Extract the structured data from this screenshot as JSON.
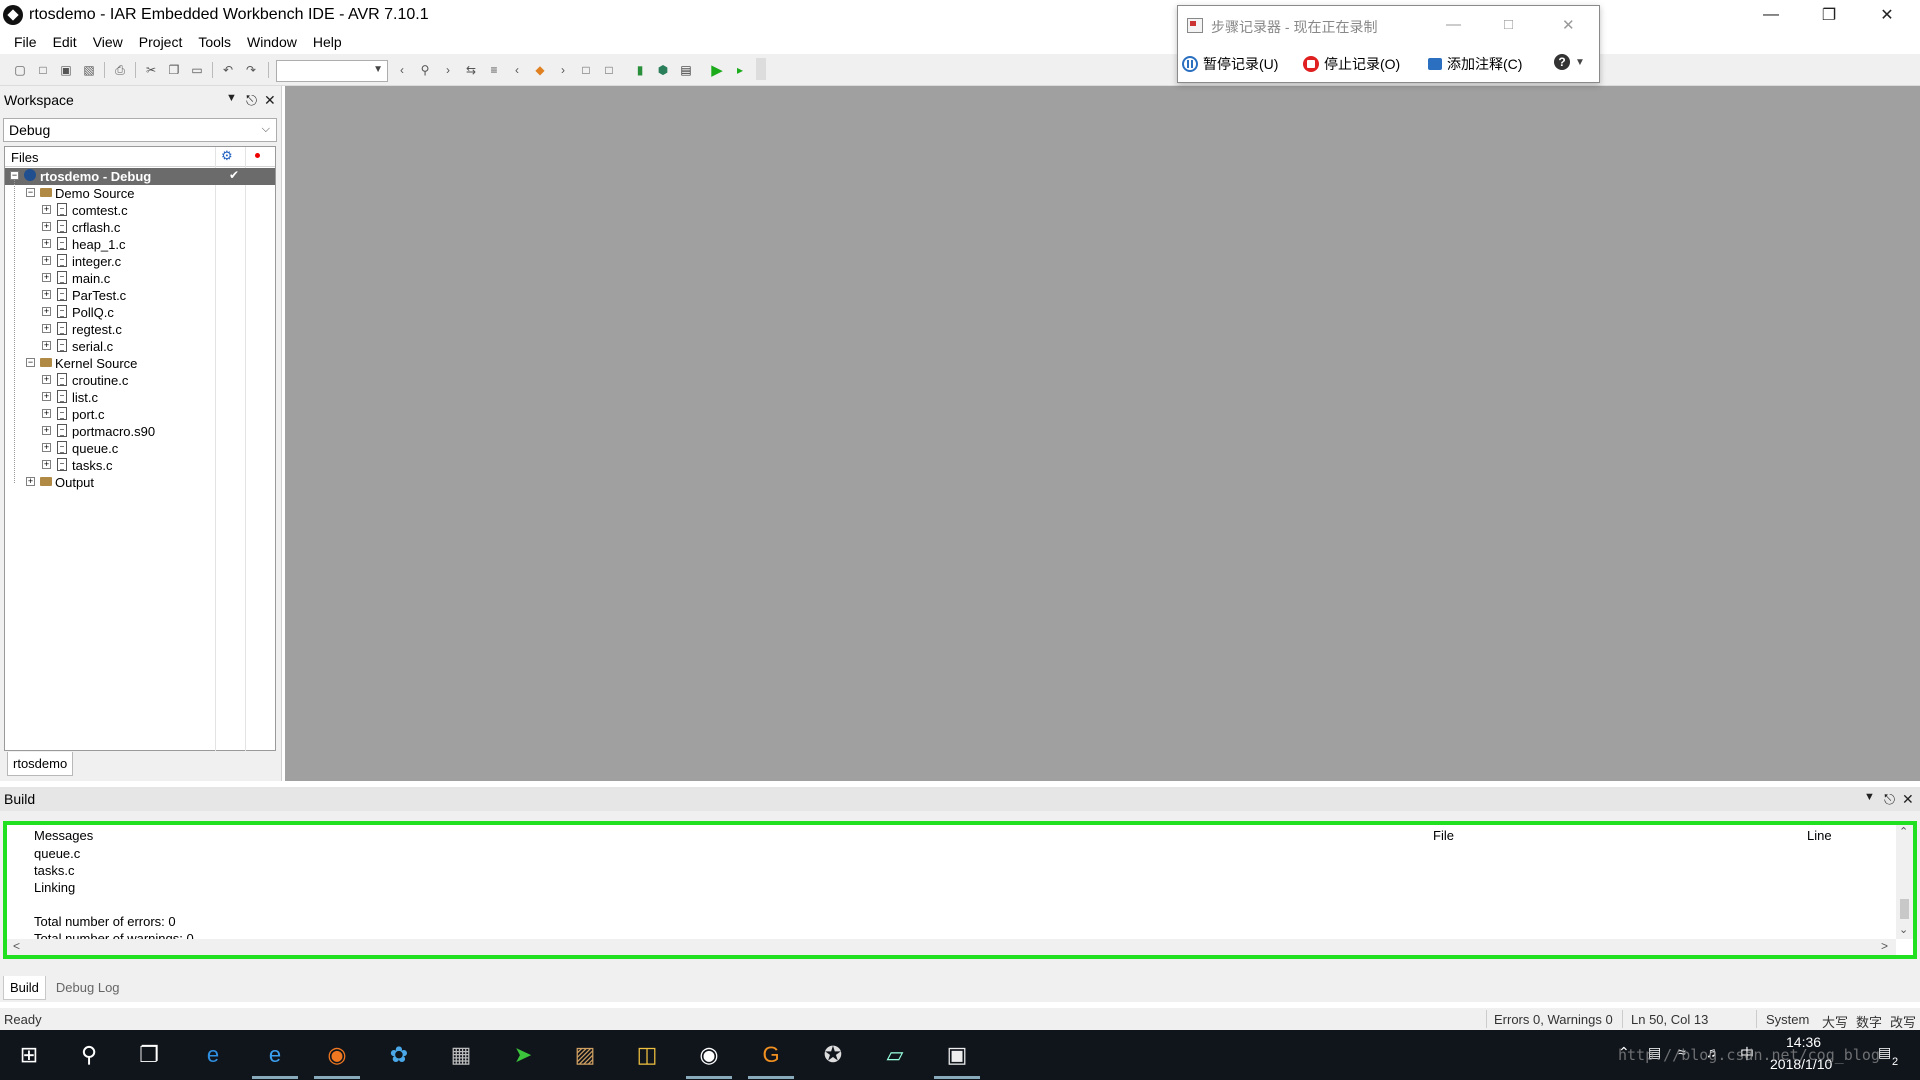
{
  "window": {
    "title": "rtosdemo - IAR Embedded Workbench IDE - AVR 7.10.1",
    "minimize_icon": "minimize-icon",
    "restore_icon": "restore-icon",
    "close_icon": "close-icon"
  },
  "menu": [
    "File",
    "Edit",
    "View",
    "Project",
    "Tools",
    "Window",
    "Help"
  ],
  "workspace": {
    "title": "Workspace",
    "configuration": "Debug",
    "files_header": "Files",
    "tab_label": "rtosdemo",
    "tree": {
      "project": "rtosdemo - Debug",
      "groups": [
        {
          "name": "Demo Source",
          "files": [
            "comtest.c",
            "crflash.c",
            "heap_1.c",
            "integer.c",
            "main.c",
            "ParTest.c",
            "PollQ.c",
            "regtest.c",
            "serial.c"
          ]
        },
        {
          "name": "Kernel Source",
          "files": [
            "croutine.c",
            "list.c",
            "port.c",
            "portmacro.s90",
            "queue.c",
            "tasks.c"
          ]
        },
        {
          "name": "Output",
          "files": []
        }
      ]
    }
  },
  "build": {
    "title": "Build",
    "columns": [
      "Messages",
      "File",
      "Line"
    ],
    "messages": [
      "queue.c",
      "tasks.c",
      "Linking",
      "",
      "Total number of errors: 0",
      "Total number of warnings: 0"
    ],
    "tabs": [
      "Build",
      "Debug Log"
    ],
    "highlight_color": "#20e020"
  },
  "status": {
    "ready": "Ready",
    "errors": "Errors 0, Warnings 0",
    "position": "Ln 50, Col 13",
    "system": "System",
    "caps": "大写",
    "num": "数字",
    "ovr": "改写"
  },
  "steps_recorder": {
    "title": "步骤记录器 - 现在正在录制",
    "pause": "暂停记录(U)",
    "stop": "停止记录(O)",
    "comment": "添加注释(C)"
  },
  "taskbar": {
    "time": "14:36",
    "date": "2018/1/10",
    "ime": "中",
    "notifications": "2",
    "watermark": "http://blog.csdn.net/cog_blog"
  }
}
